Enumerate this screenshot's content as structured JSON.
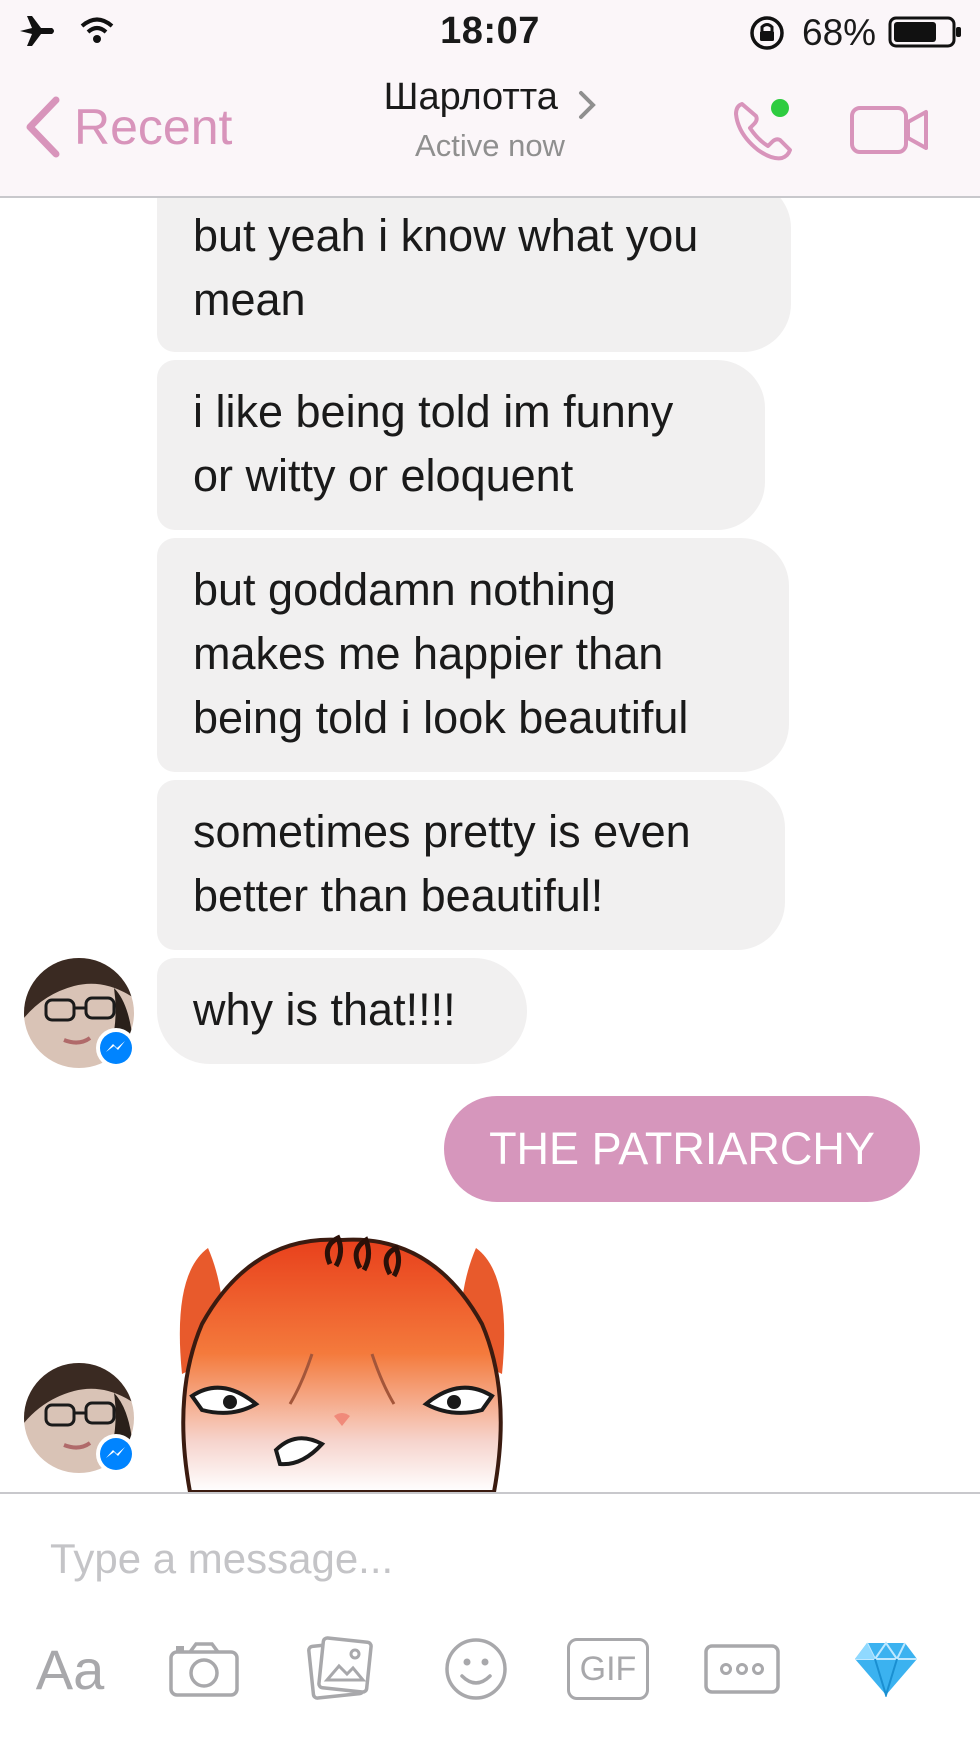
{
  "status_bar": {
    "time": "18:07",
    "battery_text": "68%",
    "icons": [
      "airplane-icon",
      "wifi-icon",
      "rotation-lock-icon",
      "battery-icon"
    ]
  },
  "nav": {
    "back_label": "Recent",
    "contact_name": "Шарлотта",
    "contact_status": "Active now",
    "icons": [
      "back-chevron-icon",
      "phone-icon",
      "video-icon"
    ],
    "accent_color": "#d894bb",
    "online_dot_color": "#2ecc40"
  },
  "messages": [
    {
      "from": "them",
      "text_lines": [
        "but yeah i know what you",
        "mean"
      ]
    },
    {
      "from": "them",
      "text_lines": [
        "i like being told im funny",
        "or witty or eloquent"
      ]
    },
    {
      "from": "them",
      "text_lines": [
        "but goddamn nothing",
        "makes me happier than",
        "being told i look beautiful"
      ]
    },
    {
      "from": "them",
      "text_lines": [
        "sometimes pretty is even",
        "better than beautiful!"
      ]
    },
    {
      "from": "them",
      "text_lines": [
        "why is that!!!!"
      ]
    },
    {
      "from": "me",
      "text_lines": [
        "THE PATRIARCHY"
      ]
    },
    {
      "from": "them",
      "sticker": "angry-face-sticker"
    }
  ],
  "colors": {
    "received_bubble": "#f1f0f0",
    "sent_bubble": "#d696bc",
    "messenger_badge": "#0084ff"
  },
  "composer": {
    "placeholder": "Type a message...",
    "aa_label": "Aa",
    "gif_label": "GIF",
    "tools": [
      "text-style-button",
      "camera-icon",
      "photo-icon",
      "emoji-icon",
      "gif-button",
      "more-icon",
      "diamond-icon"
    ]
  }
}
